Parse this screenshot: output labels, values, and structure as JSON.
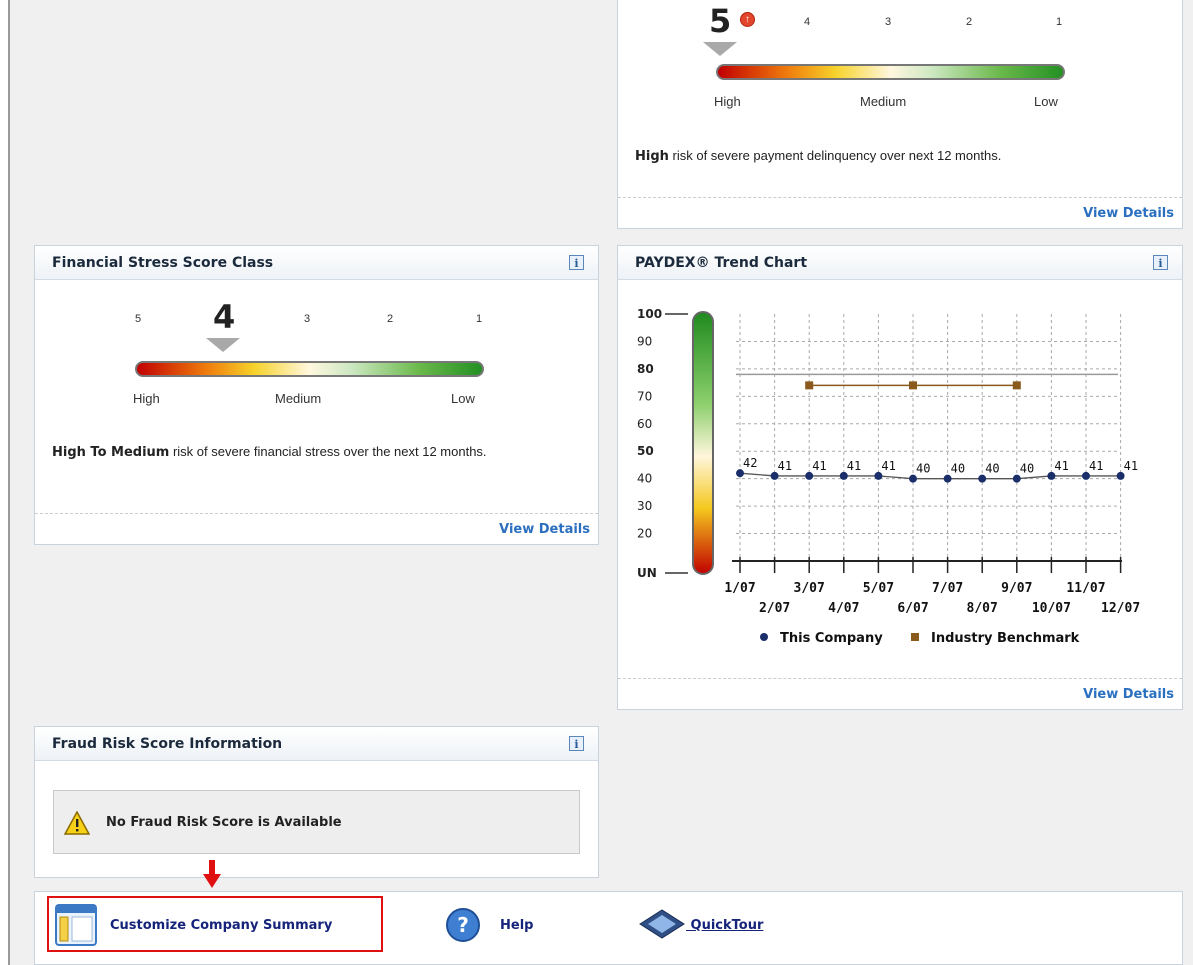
{
  "colors": {
    "accent_link": "#2a6fc0",
    "high": "#c10000",
    "low": "#249024",
    "this_company": "#1a2e6a",
    "industry": "#8a5a1c",
    "highlight_border": "#e01010",
    "arrow": "#e01010"
  },
  "top_panel": {
    "score_value": "5",
    "score_trend_icon": "up-arrow-icon",
    "scale_labels": [
      "4",
      "3",
      "2",
      "1"
    ],
    "levels": {
      "high": "High",
      "medium": "Medium",
      "low": "Low"
    },
    "description_bold": "High",
    "description_rest": " risk of severe payment delinquency over next 12 months.",
    "view_details": "View Details"
  },
  "financial_stress": {
    "title": "Financial Stress Score Class",
    "score_value": "4",
    "scale_labels": [
      "5",
      "3",
      "2",
      "1"
    ],
    "levels": {
      "high": "High",
      "medium": "Medium",
      "low": "Low"
    },
    "description_bold": "High To Medium",
    "description_rest": " risk of severe financial stress over the next 12 months.",
    "view_details": "View Details"
  },
  "paydex": {
    "title": "PAYDEX® Trend Chart",
    "view_details": "View Details"
  },
  "chart_data": {
    "type": "line",
    "y_tick_labels": [
      "100",
      "90",
      "80",
      "70",
      "60",
      "50",
      "40",
      "30",
      "20",
      "UN"
    ],
    "x_labels_row1": [
      "1/07",
      "3/07",
      "5/07",
      "7/07",
      "9/07",
      "11/07"
    ],
    "x_labels_row2": [
      "2/07",
      "4/07",
      "6/07",
      "8/07",
      "10/07",
      "12/07"
    ],
    "categories": [
      "1/07",
      "2/07",
      "3/07",
      "4/07",
      "5/07",
      "6/07",
      "7/07",
      "8/07",
      "9/07",
      "10/07",
      "11/07",
      "12/07"
    ],
    "ylim": [
      10,
      100
    ],
    "grid": true,
    "legend_position": "bottom",
    "series": [
      {
        "name": "This Company",
        "values": [
          42,
          41,
          41,
          41,
          41,
          40,
          40,
          40,
          40,
          41,
          41,
          41
        ],
        "labels": [
          "42",
          "41",
          "41",
          "41",
          "41",
          "40",
          "40",
          "40",
          "40",
          "41",
          "41",
          "41"
        ]
      },
      {
        "name": "Industry Benchmark",
        "points": [
          {
            "x": "3/07",
            "y": 74
          },
          {
            "x": "6/07",
            "y": 74
          },
          {
            "x": "9/07",
            "y": 74
          }
        ]
      }
    ],
    "reference_lines": [
      78
    ]
  },
  "fraud": {
    "title": "Fraud Risk Score Information",
    "message": "No Fraud Risk Score is Available",
    "icon": "warning-icon"
  },
  "toolbar": {
    "customize_label": "Customize Company Summary",
    "help_label": "Help",
    "quicktour_label": " QuickTour"
  }
}
